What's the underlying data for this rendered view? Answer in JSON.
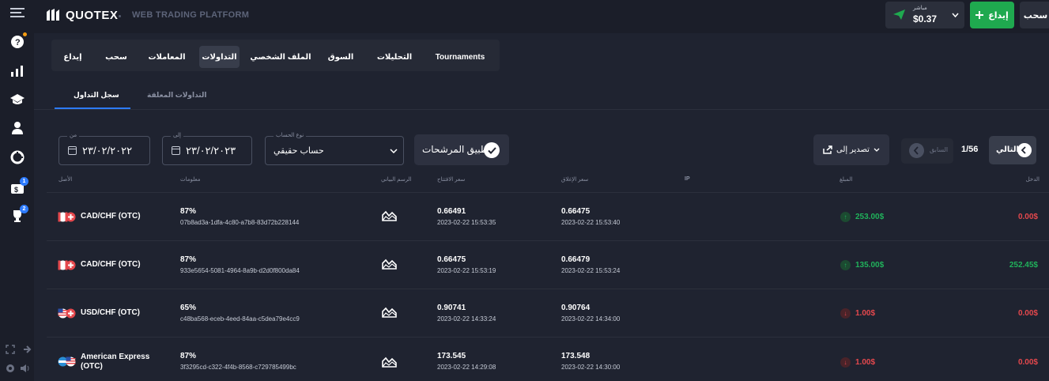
{
  "app": {
    "logo_text": "QUOTEX",
    "tagline": "WEB TRADING PLATFORM"
  },
  "header": {
    "account_label": "مباشر",
    "balance": "$0.37",
    "deposit_label": "إيداع",
    "withdraw_label": "سحب"
  },
  "sidebar": {
    "icons": [
      "menu-icon",
      "help-chat-icon",
      "chart-bars-icon",
      "education-icon",
      "user-icon",
      "pie-icon",
      "tickets-icon",
      "trophy-icon"
    ],
    "badges": {
      "tickets": "1",
      "trophy": "2"
    }
  },
  "menu": {
    "items": [
      "Tournaments",
      "التحليلات",
      "السوق",
      "الملف الشخصي",
      "التداولات",
      "المعاملات",
      "سحب",
      "إيداع"
    ],
    "active": "التداولات"
  },
  "subtabs": {
    "history": "سجل التداول",
    "pending": "التداولات المعلقة"
  },
  "filters": {
    "from_label": "من",
    "from_value": "٢٣/٠٢/٢٠٢٢",
    "to_label": "إلى",
    "to_value": "٢٣/٠٢/٢٠٢٣",
    "account_label": "نوع الحساب",
    "account_value": "حساب حقيقي",
    "apply_label": "تطبيق المرشحات",
    "export_label": "تصدير إلى",
    "prev_label": "السابق",
    "page": "1/56",
    "next_label": "التالي"
  },
  "table": {
    "headers": {
      "asset": "الأصل",
      "info": "معلومات",
      "chart": "الرسم البياني",
      "open": "سعر الافتتاح",
      "close": "سعر الإغلاق",
      "ip": "IP",
      "amount": "المبلغ",
      "income": "الدخل"
    },
    "rows": [
      {
        "asset": "CAD/CHF (OTC)",
        "percent": "87%",
        "id": "07b8ad3a-1dfa-4c80-a7b8-83d72b228144",
        "open_price": "0.66491",
        "open_time": "2023-02-22 15:53:35",
        "close_price": "0.66475",
        "close_time": "2023-02-22 15:53:40",
        "direction": "up",
        "amount": "253.00$",
        "income": "0.00$"
      },
      {
        "asset": "CAD/CHF (OTC)",
        "percent": "87%",
        "id": "933e5654-5081-4964-8a9b-d2d0f800da84",
        "open_price": "0.66475",
        "open_time": "2023-02-22 15:53:19",
        "close_price": "0.66479",
        "close_time": "2023-02-22 15:53:24",
        "direction": "up",
        "amount": "135.00$",
        "income": "252.45$"
      },
      {
        "asset": "USD/CHF (OTC)",
        "percent": "65%",
        "id": "c48ba568-eceb-4eed-84aa-c5dea79e4cc9",
        "open_price": "0.90741",
        "open_time": "2023-02-22 14:33:24",
        "close_price": "0.90764",
        "close_time": "2023-02-22 14:34:00",
        "direction": "down",
        "amount": "1.00$",
        "income": "0.00$"
      },
      {
        "asset": "American Express (OTC)",
        "percent": "87%",
        "id": "3f3295cd-c322-4f4b-8568-c729785499bc",
        "open_price": "173.545",
        "open_time": "2023-02-22 14:29:08",
        "close_price": "173.548",
        "close_time": "2023-02-22 14:30:00",
        "direction": "down",
        "amount": "1.00$",
        "income": "0.00$"
      }
    ]
  },
  "colors": {
    "accent_green": "#1fa94f",
    "accent_blue": "#2d7bff",
    "loss_red": "#e5484d",
    "win_green": "#20b25b"
  }
}
